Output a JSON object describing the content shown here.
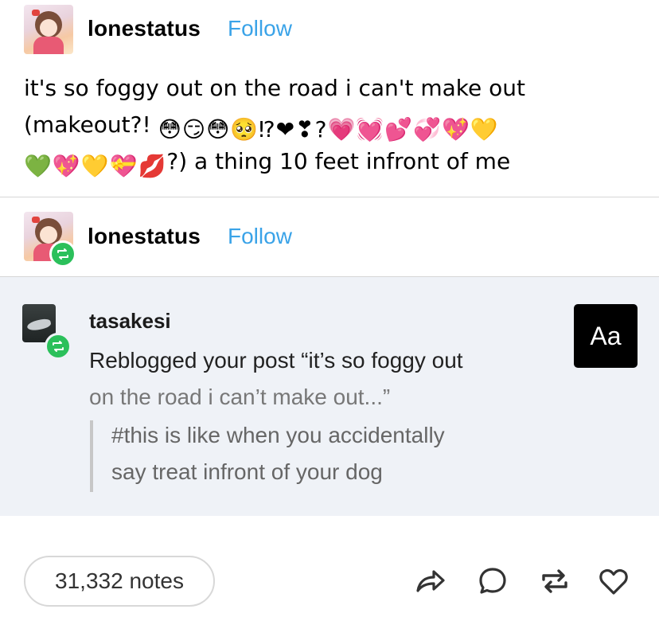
{
  "post": {
    "username": "lonestatus",
    "follow_label": "Follow",
    "text_line1": "it's so foggy out on the road i can't make out",
    "text_line2_start": "(makeout?!",
    "text_line2_emojis": [
      "😳",
      "😏",
      "😳",
      "🥺",
      "⁉",
      "❤",
      "❣",
      "?",
      "💗",
      "💓",
      "💕",
      "💞",
      "💖",
      "💛"
    ],
    "text_line3_emojis": [
      "💚",
      "💖",
      "💛",
      "💝",
      "💋"
    ],
    "text_line3_end": "?) a thing 10 feet infront of me"
  },
  "reblog": {
    "username": "lonestatus",
    "follow_label": "Follow"
  },
  "activity": {
    "username": "tasakesi",
    "line1": "Reblogged your post “it’s so foggy out",
    "line2": "on the road i can’t make out...”",
    "tag_line1": "#this is like when you accidentally",
    "tag_line2": "say treat infront of your dog",
    "aa_label": "Aa"
  },
  "footer": {
    "notes_label": "31,332 notes",
    "icons": [
      "share-icon",
      "reply-icon",
      "reblog-icon",
      "like-icon"
    ]
  },
  "colors": {
    "follow": "#3aa3e8",
    "reblog_badge": "#2bc05b",
    "activity_bg": "#eff2f7"
  }
}
